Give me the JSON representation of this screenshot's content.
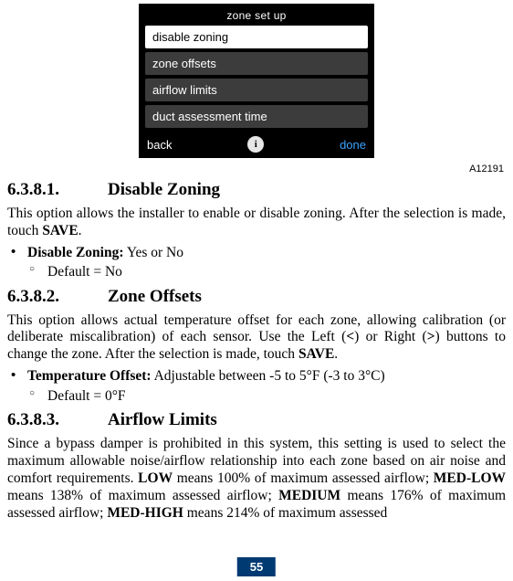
{
  "device": {
    "title": "zone set up",
    "items": [
      {
        "label": "disable zoning",
        "selected": true
      },
      {
        "label": "zone offsets",
        "selected": false
      },
      {
        "label": "airflow limits",
        "selected": false
      },
      {
        "label": "duct assessment time",
        "selected": false
      }
    ],
    "back": "back",
    "info": "i",
    "done": "done"
  },
  "figure_id": "A12191",
  "sections": [
    {
      "num": "6.3.8.1.",
      "title": "Disable Zoning",
      "paras": [
        {
          "runs": [
            {
              "t": "This option allows the installer to enable or disable zoning. After the selection is made, touch "
            },
            {
              "t": "SAVE",
              "b": true
            },
            {
              "t": "."
            }
          ]
        }
      ],
      "bullets": [
        {
          "runs": [
            {
              "t": "Disable Zoning:",
              "b": true
            },
            {
              "t": " Yes or No"
            }
          ],
          "sub": [
            {
              "runs": [
                {
                  "t": "Default = No"
                }
              ]
            }
          ]
        }
      ]
    },
    {
      "num": "6.3.8.2.",
      "title": "Zone Offsets",
      "paras": [
        {
          "runs": [
            {
              "t": "This option allows actual temperature offset for each zone, allowing calibration (or deliberate miscalibration) of each sensor. Use the Left ("
            },
            {
              "t": "<",
              "b": true
            },
            {
              "t": ") or Right ("
            },
            {
              "t": ">",
              "b": true
            },
            {
              "t": ") buttons to change the zone. After the selection is made, touch "
            },
            {
              "t": "SAVE",
              "b": true
            },
            {
              "t": "."
            }
          ]
        }
      ],
      "bullets": [
        {
          "runs": [
            {
              "t": "Temperature Offset:",
              "b": true
            },
            {
              "t": " Adjustable between -5 to 5°F (-3 to 3°C)"
            }
          ],
          "sub": [
            {
              "runs": [
                {
                  "t": "Default = 0°F"
                }
              ]
            }
          ]
        }
      ]
    },
    {
      "num": "6.3.8.3.",
      "title": "Airflow Limits",
      "paras": [
        {
          "runs": [
            {
              "t": "Since a bypass damper is prohibited in this system, this setting is used to select the maximum allowable noise/airflow relationship into each zone based on air noise and comfort requirements. "
            },
            {
              "t": "LOW",
              "b": true
            },
            {
              "t": " means 100% of maximum assessed airflow; "
            },
            {
              "t": "MED-LOW",
              "b": true
            },
            {
              "t": " means 138% of maximum assessed airflow; "
            },
            {
              "t": "MEDIUM",
              "b": true
            },
            {
              "t": " means 176% of maximum assessed airflow; "
            },
            {
              "t": "MED-HIGH",
              "b": true
            },
            {
              "t": " means 214% of maximum assessed"
            }
          ]
        }
      ],
      "bullets": []
    }
  ],
  "page_number": "55"
}
